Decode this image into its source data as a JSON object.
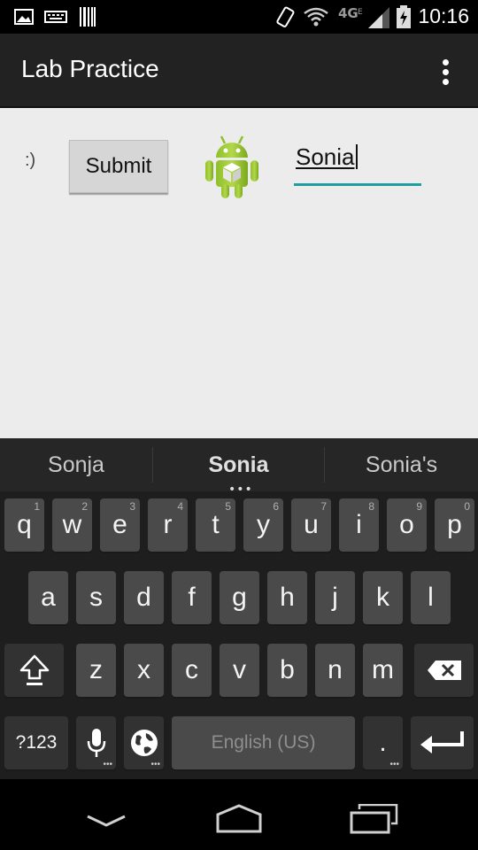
{
  "status_bar": {
    "time": "10:16",
    "icons": [
      "image-icon",
      "keyboard-icon",
      "barcode-icon",
      "vibrate-icon",
      "wifi-icon",
      "4g-icon",
      "signal-icon",
      "battery-charging-icon"
    ]
  },
  "action_bar": {
    "title": "Lab Practice",
    "overflow_icon": "overflow-menu-icon"
  },
  "content": {
    "smiley_text": ":)",
    "submit_label": "Submit",
    "image_icon": "android-robot-icon",
    "name_value": "Sonia"
  },
  "keyboard": {
    "suggestions": [
      "Sonja",
      "Sonia",
      "Sonia's"
    ],
    "row1": [
      {
        "label": "q",
        "hint": "1"
      },
      {
        "label": "w",
        "hint": "2"
      },
      {
        "label": "e",
        "hint": "3"
      },
      {
        "label": "r",
        "hint": "4"
      },
      {
        "label": "t",
        "hint": "5"
      },
      {
        "label": "y",
        "hint": "6"
      },
      {
        "label": "u",
        "hint": "7"
      },
      {
        "label": "i",
        "hint": "8"
      },
      {
        "label": "o",
        "hint": "9"
      },
      {
        "label": "p",
        "hint": "0"
      }
    ],
    "row2": [
      "a",
      "s",
      "d",
      "f",
      "g",
      "h",
      "j",
      "k",
      "l"
    ],
    "row3": [
      "z",
      "x",
      "c",
      "v",
      "b",
      "n",
      "m"
    ],
    "symbols_label": "?123",
    "space_label": "English (US)",
    "period_label": ".",
    "special_icons": [
      "shift-icon",
      "backspace-icon",
      "microphone-icon",
      "globe-icon",
      "enter-icon"
    ]
  },
  "nav_bar": {
    "icons": [
      "back-icon",
      "home-icon",
      "recents-icon"
    ]
  },
  "colors": {
    "accent": "#1e9e9e",
    "action_bar": "#222222",
    "content_bg": "#ececec",
    "key_bg": "#4a4a4a"
  }
}
